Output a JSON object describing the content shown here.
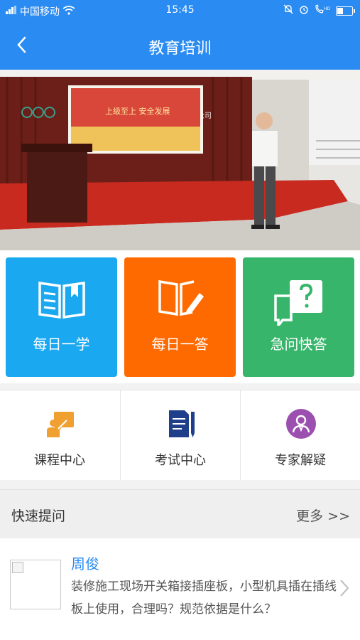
{
  "status": {
    "carrier": "中国移动",
    "time": "15:45",
    "battery_level": 0.45
  },
  "nav": {
    "title": "教育培训",
    "back_icon": "chevron-left-icon"
  },
  "banner": {
    "screen_slogan": "上级至上 安全发展"
  },
  "tiles": [
    {
      "label": "每日一学",
      "color": "#1aa8f0",
      "icon": "book-open-icon"
    },
    {
      "label": "每日一答",
      "color": "#ff6a00",
      "icon": "book-pen-icon"
    },
    {
      "label": "急问快答",
      "color": "#37b56a",
      "icon": "question-chat-icon"
    }
  ],
  "services": [
    {
      "label": "课程中心",
      "icon": "teacher-board-icon"
    },
    {
      "label": "考试中心",
      "icon": "exam-paper-icon"
    },
    {
      "label": "专家解疑",
      "icon": "expert-user-icon"
    }
  ],
  "quick_ask": {
    "title": "快速提问",
    "more": "更多 >>"
  },
  "question": {
    "name": "周俊",
    "text": "装修施工现场开关箱接插座板，小型机具插在插线板上使用，合理吗？规范依据是什么？"
  }
}
